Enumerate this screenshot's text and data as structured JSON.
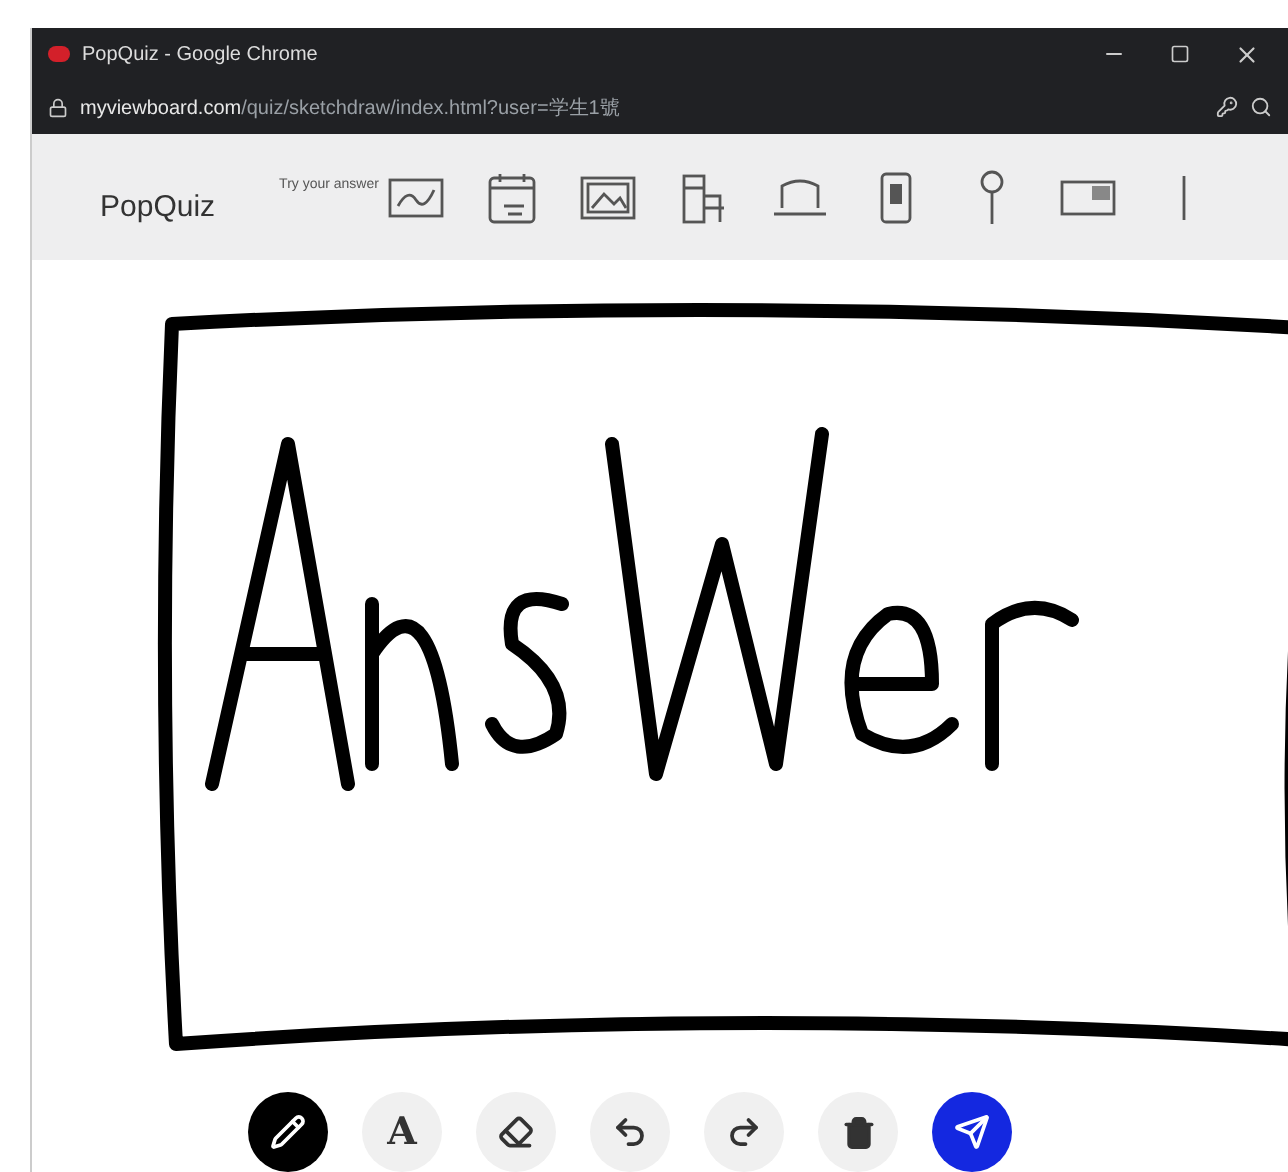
{
  "window": {
    "title": "PopQuiz - Google Chrome",
    "url_domain": "myviewboard.com",
    "url_path": "/quiz/sketchdraw/index.html?user=学生1號"
  },
  "app": {
    "name": "PopQuiz",
    "hint": "Try your answer"
  },
  "templates": [
    {
      "kind": "graph"
    },
    {
      "kind": "calendar"
    },
    {
      "kind": "frame"
    },
    {
      "kind": "bars"
    },
    {
      "kind": "laptop"
    },
    {
      "kind": "phone"
    },
    {
      "kind": "pin"
    },
    {
      "kind": "screen"
    },
    {
      "kind": "more"
    }
  ],
  "tools": [
    {
      "kind": "pen",
      "selected": true
    },
    {
      "kind": "text",
      "glyph": "A",
      "selected": false
    },
    {
      "kind": "eraser",
      "selected": false
    },
    {
      "kind": "undo",
      "selected": false
    },
    {
      "kind": "redo",
      "selected": false
    },
    {
      "kind": "delete",
      "selected": false
    },
    {
      "kind": "send",
      "selected": false
    }
  ]
}
